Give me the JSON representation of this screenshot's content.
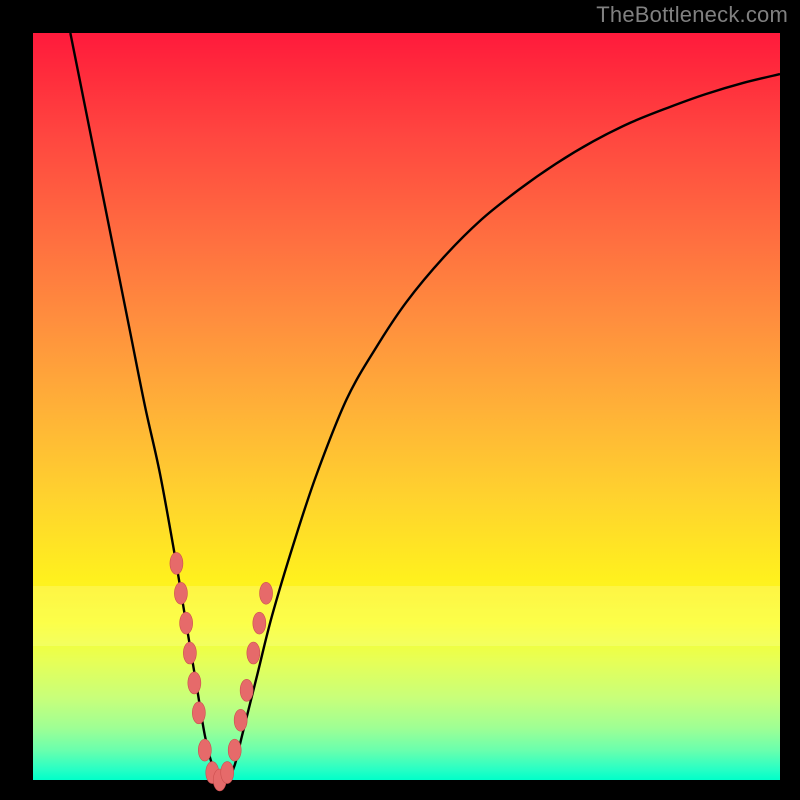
{
  "watermark": "TheBottleneck.com",
  "colors": {
    "frame": "#000000",
    "curve_stroke": "#000000",
    "marker_fill": "#e66a6a",
    "marker_stroke": "#cc4e4e"
  },
  "chart_data": {
    "type": "line",
    "title": "",
    "xlabel": "",
    "ylabel": "",
    "xlim": [
      0,
      100
    ],
    "ylim": [
      0,
      100
    ],
    "background_gradient": [
      "#ff1a3c",
      "#ff6a40",
      "#ffd22e",
      "#fbff26",
      "#00ffc9"
    ],
    "series": [
      {
        "name": "bottleneck-curve",
        "x": [
          5,
          7,
          9,
          11,
          13,
          15,
          17,
          19,
          20,
          21,
          22,
          23,
          24,
          25,
          26,
          27,
          28,
          30,
          32,
          35,
          38,
          42,
          46,
          50,
          55,
          60,
          65,
          70,
          75,
          80,
          85,
          90,
          95,
          100
        ],
        "y": [
          100,
          90,
          80,
          70,
          60,
          50,
          41,
          30,
          24,
          18,
          12,
          6,
          2,
          0,
          0,
          2,
          6,
          14,
          22,
          32,
          41,
          51,
          58,
          64,
          70,
          75,
          79,
          82.5,
          85.5,
          88,
          90,
          91.8,
          93.3,
          94.5
        ]
      }
    ],
    "markers": {
      "name": "highlighted-points",
      "x": [
        19.2,
        19.8,
        20.5,
        21.0,
        21.6,
        22.2,
        23.0,
        24.0,
        25.0,
        26.0,
        27.0,
        27.8,
        28.6,
        29.5,
        30.3,
        31.2
      ],
      "y": [
        29,
        25,
        21,
        17,
        13,
        9,
        4,
        1,
        0,
        1,
        4,
        8,
        12,
        17,
        21,
        25
      ]
    },
    "highlight_band_y": [
      18,
      26
    ]
  }
}
